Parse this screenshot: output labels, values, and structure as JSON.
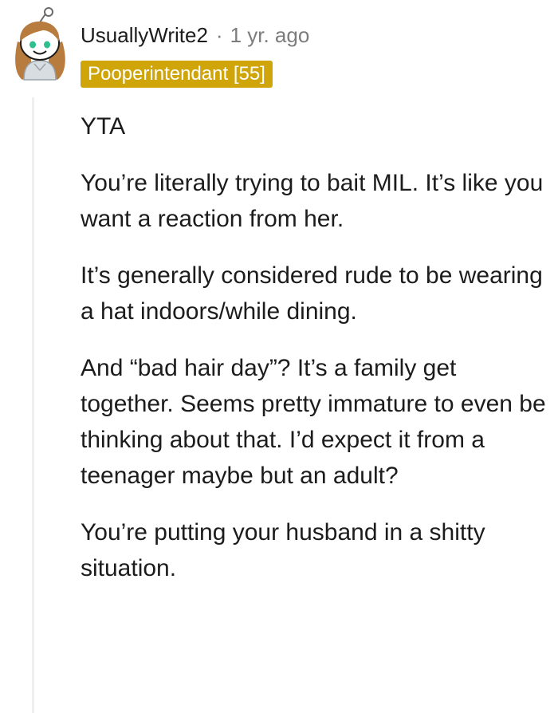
{
  "comment": {
    "author": "UsuallyWrite2",
    "separator": "·",
    "timestamp": "1 yr. ago",
    "flair": "Pooperintendant [55]",
    "avatar_icon": "snoo-avatar-icon",
    "colors": {
      "flair_background": "#cfa509",
      "flair_text": "#ffffff",
      "meta_text": "#7c7c7c",
      "body_text": "#1c1c1c",
      "thread_line": "#edeff1"
    },
    "paragraphs": [
      "YTA",
      "You’re literally trying to bait MIL. It’s like you want a reaction from her.",
      "It’s generally considered rude to be wearing a hat indoors/while dining.",
      "And “bad hair day”? It’s a family get together. Seems pretty immature to even be thinking about that. I’d expect it from a teenager maybe but an adult?",
      "You’re putting your husband in a shitty situation."
    ]
  }
}
